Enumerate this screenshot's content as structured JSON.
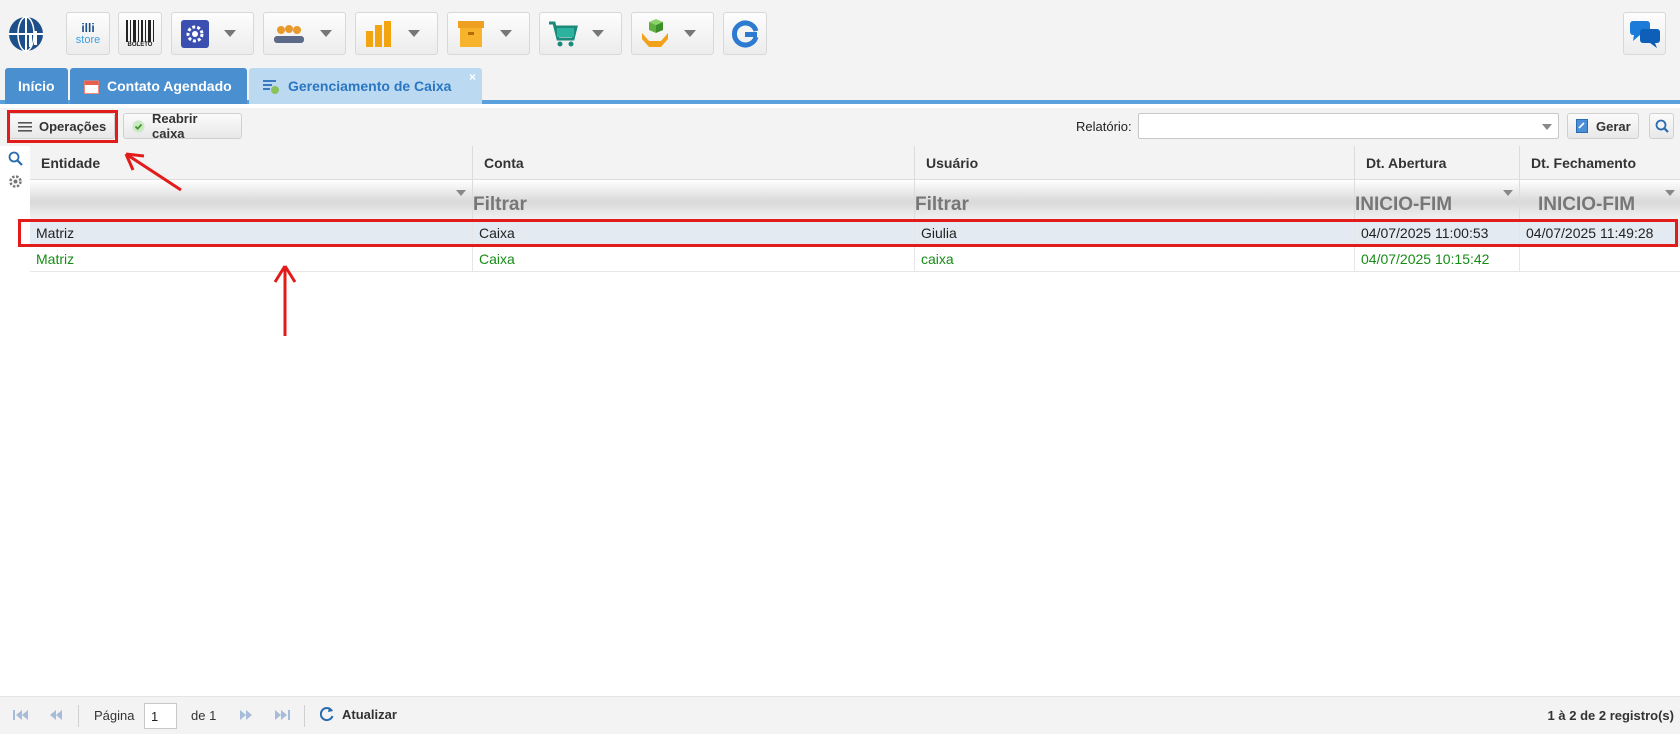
{
  "topbar": {
    "icons": [
      "globe-logo-icon",
      "illi-store-icon",
      "boleto-barcode-icon",
      "settings-gear-icon",
      "users-group-icon",
      "bar-chart-icon",
      "box-archive-icon",
      "shopping-cart-icon",
      "package-hands-icon",
      "g-refresh-icon",
      "chat-bubbles-icon"
    ],
    "illi_text": "illi",
    "store_text": "store",
    "boleto_text": "BOLETO"
  },
  "tabs": [
    {
      "label": "Início"
    },
    {
      "label": "Contato Agendado"
    },
    {
      "label": "Gerenciamento de Caixa",
      "close": "×"
    }
  ],
  "toolbar": {
    "operacoes": "Operações",
    "reabrir": "Reabrir caixa",
    "relatorio_label": "Relatório:",
    "relatorio_value": "",
    "gerar": "Gerar"
  },
  "grid": {
    "columns": [
      "Entidade",
      "Conta",
      "Usuário",
      "Dt. Abertura",
      "Dt. Fechamento"
    ],
    "filters": [
      "",
      "Filtrar",
      "Filtrar",
      "INICIO-FIM",
      "INICIO-FIM"
    ],
    "rows": [
      {
        "entidade": "Matriz",
        "conta": "Caixa",
        "usuario": "Giulia",
        "abertura": "04/07/2025 11:00:53",
        "fechamento": "04/07/2025 11:49:28"
      },
      {
        "entidade": "Matriz",
        "conta": "Caixa",
        "usuario": "caixa",
        "abertura": "04/07/2025 10:15:42",
        "fechamento": ""
      }
    ]
  },
  "footer": {
    "pagina_label": "Página",
    "page": "1",
    "de_label": "de 1",
    "atualizar": "Atualizar",
    "records": "1 à 2 de 2 registro(s)"
  },
  "colors": {
    "tab_blue": "#4a8fcf",
    "tab_active": "#bcd9f2",
    "highlight": "#e21b1b",
    "green_text": "#168c16"
  }
}
